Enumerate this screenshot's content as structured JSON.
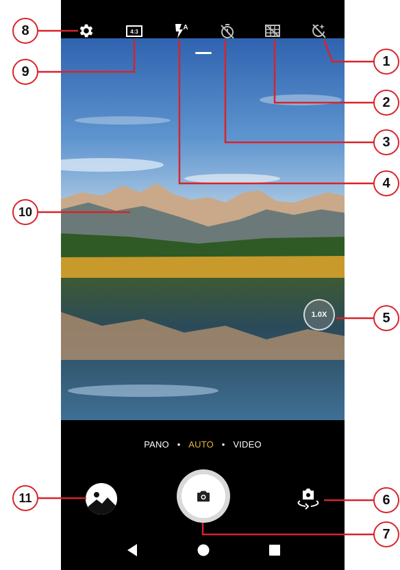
{
  "top_bar": {
    "icons": [
      "gear-icon",
      "aspect-ratio-icon",
      "flash-auto-icon",
      "timer-icon",
      "grid-icon",
      "hdr-off-icon"
    ],
    "aspect_ratio_label": "4:3",
    "flash_mode_label": "A"
  },
  "viewfinder": {
    "zoom_label": "1.0X"
  },
  "modes": {
    "items": [
      "PANO",
      "AUTO",
      "VIDEO"
    ],
    "separator": "•",
    "active": "AUTO",
    "active_color": "#e8b53a"
  },
  "controls": {
    "gallery_icon": "gallery-icon",
    "shutter_icon": "camera-icon",
    "switch_camera_icon": "switch-camera-icon"
  },
  "nav_bar": {
    "items": [
      "back-icon",
      "home-icon",
      "recents-icon"
    ]
  },
  "callouts": {
    "color": "#d8232a",
    "labels": [
      "1",
      "2",
      "3",
      "4",
      "5",
      "6",
      "7",
      "8",
      "9",
      "10",
      "11"
    ]
  }
}
